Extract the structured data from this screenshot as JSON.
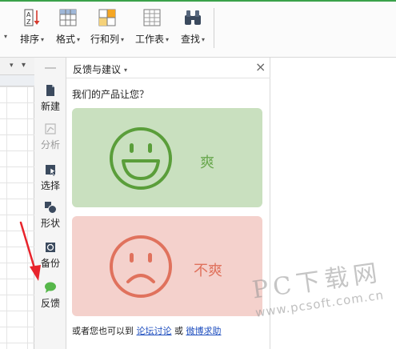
{
  "ribbon": {
    "buttons": [
      {
        "id": "sort",
        "label": "排序",
        "icon": "sort-az-icon"
      },
      {
        "id": "format",
        "label": "格式",
        "icon": "format-icon"
      },
      {
        "id": "rowcol",
        "label": "行和列",
        "icon": "row-column-icon"
      },
      {
        "id": "sheet",
        "label": "工作表",
        "icon": "worksheet-icon"
      },
      {
        "id": "find",
        "label": "查找",
        "icon": "binoculars-icon"
      }
    ],
    "caret": "▾"
  },
  "sheet": {
    "ribbon_letter": "▾",
    "corner_icon": "▾"
  },
  "vbar": {
    "items": [
      {
        "label": "新建",
        "icon": "new-doc-icon",
        "enabled": true
      },
      {
        "label": "分析",
        "icon": "analyze-icon",
        "enabled": false
      },
      {
        "label": "选择",
        "icon": "select-icon",
        "enabled": true
      },
      {
        "label": "形状",
        "icon": "shape-icon",
        "enabled": true
      },
      {
        "label": "备份",
        "icon": "backup-icon",
        "enabled": true
      },
      {
        "label": "反馈",
        "icon": "feedback-bubble-icon",
        "enabled": true
      }
    ]
  },
  "panel": {
    "title": "反馈与建议",
    "caret": "▾",
    "close": "×",
    "question": "我们的产品让您？",
    "good_label": "爽",
    "bad_label": "不爽",
    "footer_prefix": "或者您也可以到",
    "forum_link": "论坛讨论",
    "footer_or": "或",
    "weibo_link": "微博求助"
  },
  "colors": {
    "accent_green": "#3aa24a",
    "good_bg": "#c9e0bf",
    "good_fg": "#5a9e3a",
    "bad_bg": "#f4d1cc",
    "bad_fg": "#e0725d",
    "link": "#1f4fbf",
    "arrow": "#e8242c"
  },
  "watermark": {
    "line1": "PC下载网",
    "line2": "www.pcsoft.com.cn"
  }
}
